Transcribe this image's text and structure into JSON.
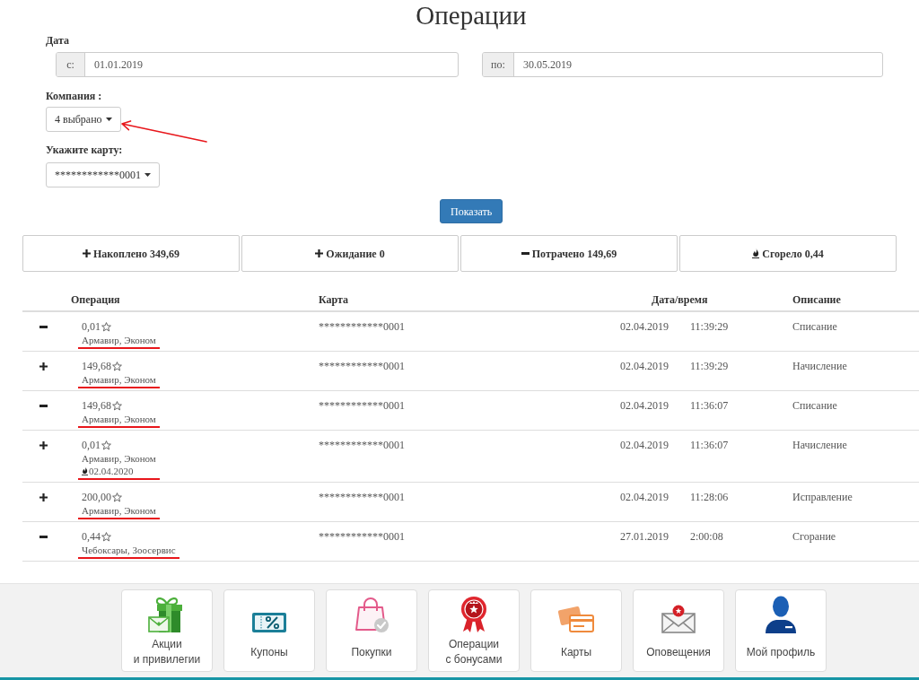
{
  "page_title": "Операции",
  "filters": {
    "date_label": "Дата",
    "date_from": {
      "prefix": "с:",
      "value": "01.01.2019"
    },
    "date_to": {
      "prefix": "по:",
      "value": "30.05.2019"
    },
    "company": {
      "label": "Компания :",
      "value": "4 выбрано",
      "annotated": true
    },
    "card": {
      "label": "Укажите карту:",
      "value": "************0001"
    },
    "submit": "Показать"
  },
  "summary": [
    {
      "kind": "plus",
      "label": "Накоплено 349,69"
    },
    {
      "kind": "plus",
      "label": "Ожидание 0"
    },
    {
      "kind": "minus",
      "label": "Потрачено 149,69"
    },
    {
      "kind": "fire",
      "label": "Сгорело 0,44"
    }
  ],
  "table": {
    "columns": [
      "Операция",
      "Карта",
      "Дата/время",
      "Описание"
    ],
    "rows": [
      {
        "kind": "minus",
        "amount": "0,01",
        "company": "Армавир, Эконом",
        "card": "************0001",
        "date": "02.04.2019",
        "time": "11:39:29",
        "description": "Списание",
        "underlined": true
      },
      {
        "kind": "plus",
        "amount": "149,68",
        "company": "Армавир, Эконом",
        "card": "************0001",
        "date": "02.04.2019",
        "time": "11:39:29",
        "description": "Начисление",
        "underlined": true
      },
      {
        "kind": "minus",
        "amount": "149,68",
        "company": "Армавир, Эконом",
        "card": "************0001",
        "date": "02.04.2019",
        "time": "11:36:07",
        "description": "Списание",
        "underlined": true
      },
      {
        "kind": "plus",
        "amount": "0,01",
        "company": "Армавир, Эконом",
        "expiry": "02.04.2020",
        "card": "************0001",
        "date": "02.04.2019",
        "time": "11:36:07",
        "description": "Начисление",
        "underlined": true
      },
      {
        "kind": "plus",
        "amount": "200,00",
        "company": "Армавир, Эконом",
        "card": "************0001",
        "date": "02.04.2019",
        "time": "11:28:06",
        "description": "Исправление",
        "underlined": true
      },
      {
        "kind": "minus",
        "amount": "0,44",
        "company": "Чебоксары, Зоосервис",
        "card": "************0001",
        "date": "27.01.2019",
        "time": "2:00:08",
        "description": "Сгорание",
        "underlined": true
      }
    ]
  },
  "nav": [
    {
      "kind": "gift",
      "label": "Акции\nи привилегии"
    },
    {
      "kind": "coupon",
      "label": "Купоны"
    },
    {
      "kind": "bag",
      "label": "Покупки"
    },
    {
      "kind": "medal",
      "label": "Операции\nс бонусами"
    },
    {
      "kind": "cards",
      "label": "Карты"
    },
    {
      "kind": "envelope",
      "label": "Оповещения"
    },
    {
      "kind": "person",
      "label": "Мой профиль"
    }
  ]
}
